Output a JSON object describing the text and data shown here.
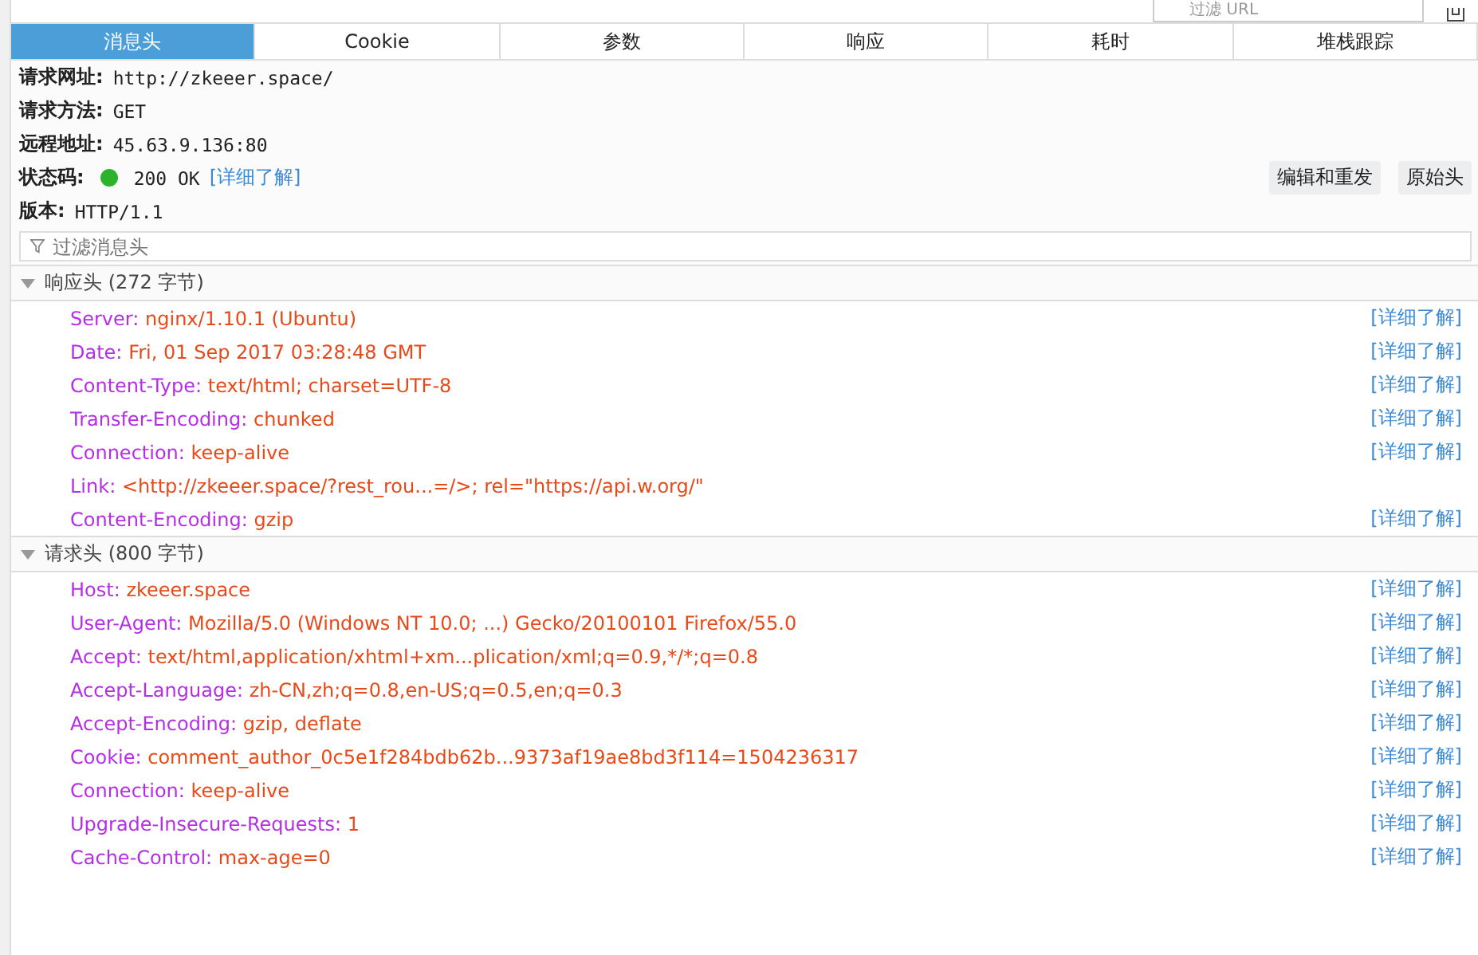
{
  "top_filter": {
    "placeholder": "过滤 URL"
  },
  "tabs": [
    {
      "label": "消息头",
      "selected": true
    },
    {
      "label": "Cookie",
      "selected": false
    },
    {
      "label": "参数",
      "selected": false
    },
    {
      "label": "响应",
      "selected": false
    },
    {
      "label": "耗时",
      "selected": false
    },
    {
      "label": "堆栈跟踪",
      "selected": false
    }
  ],
  "summary": [
    {
      "label": "请求网址:",
      "value": "http://zkeeer.space/"
    },
    {
      "label": "请求方法:",
      "value": "GET"
    },
    {
      "label": "远程地址:",
      "value": "45.63.9.136:80"
    },
    {
      "label": "状态码:",
      "value": "200 OK",
      "color": "#2bb32b",
      "more": "[详细了解]"
    },
    {
      "label": "版本:",
      "value": "HTTP/1.1"
    }
  ],
  "actions": [
    "编辑和重发",
    "原始头"
  ],
  "filter": {
    "placeholder": "过滤消息头"
  },
  "sections": [
    {
      "title": "响应头 (272 字节)",
      "expanded": true,
      "headers": [
        {
          "name": "Server:",
          "value": "nginx/1.10.1 (Ubuntu)",
          "more": "[详细了解]"
        },
        {
          "name": "Date:",
          "value": "Fri, 01 Sep 2017 03:28:48 GMT",
          "more": "[详细了解]"
        },
        {
          "name": "Content-Type:",
          "value": "text/html; charset=UTF-8",
          "more": "[详细了解]"
        },
        {
          "name": "Transfer-Encoding:",
          "value": "chunked",
          "more": "[详细了解]"
        },
        {
          "name": "Connection:",
          "value": "keep-alive",
          "more": "[详细了解]"
        },
        {
          "name": "Link:",
          "value": "<http://zkeeer.space/?rest_rou...=/>; rel=\"https://api.w.org/\""
        },
        {
          "name": "Content-Encoding:",
          "value": "gzip",
          "more": "[详细了解]"
        }
      ]
    },
    {
      "title": "请求头 (800 字节)",
      "expanded": true,
      "headers": [
        {
          "name": "Host:",
          "value": "zkeeer.space",
          "more": "[详细了解]"
        },
        {
          "name": "User-Agent:",
          "value": "Mozilla/5.0 (Windows NT 10.0; ...) Gecko/20100101 Firefox/55.0",
          "more": "[详细了解]"
        },
        {
          "name": "Accept:",
          "value": "text/html,application/xhtml+xm...plication/xml;q=0.9,*/*;q=0.8",
          "more": "[详细了解]"
        },
        {
          "name": "Accept-Language:",
          "value": "zh-CN,zh;q=0.8,en-US;q=0.5,en;q=0.3",
          "more": "[详细了解]"
        },
        {
          "name": "Accept-Encoding:",
          "value": "gzip, deflate",
          "more": "[详细了解]"
        },
        {
          "name": "Cookie:",
          "value": "comment_author_0c5e1f284bdb62b...9373af19ae8bd3f114=1504236317",
          "more": "[详细了解]"
        },
        {
          "name": "Connection:",
          "value": "keep-alive",
          "more": "[详细了解]"
        },
        {
          "name": "Upgrade-Insecure-Requests:",
          "value": "1",
          "more": "[详细了解]"
        },
        {
          "name": "Cache-Control:",
          "value": "max-age=0",
          "more": "[详细了解]"
        }
      ]
    }
  ]
}
